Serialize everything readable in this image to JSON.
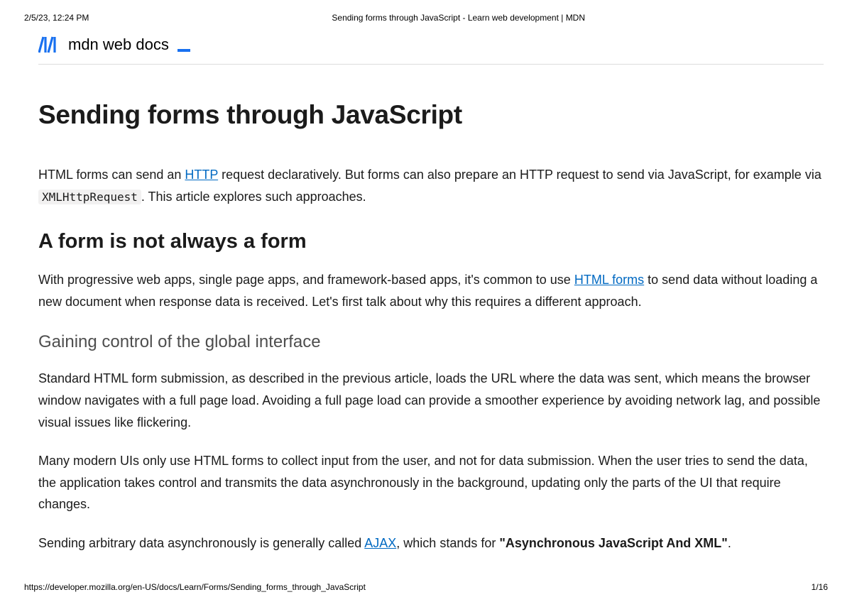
{
  "print": {
    "timestamp": "2/5/23, 12:24 PM",
    "title": "Sending forms through JavaScript - Learn web development | MDN",
    "url": "https://developer.mozilla.org/en-US/docs/Learn/Forms/Sending_forms_through_JavaScript",
    "page": "1/16"
  },
  "logo": {
    "text": "mdn web docs"
  },
  "article": {
    "title": "Sending forms through JavaScript",
    "intro": {
      "part1": "HTML forms can send an ",
      "link1": "HTTP",
      "part2": " request declaratively. But forms can also prepare an HTTP request to send via JavaScript, for example via ",
      "code1": "XMLHttpRequest",
      "part3": ". This article explores such approaches."
    },
    "h2_1": "A form is not always a form",
    "p2": {
      "part1": "With progressive web apps, single page apps, and framework-based apps, it's common to use ",
      "link1": "HTML forms",
      "part2": " to send data without loading a new document when response data is received. Let's first talk about why this requires a different approach."
    },
    "h3_1": "Gaining control of the global interface",
    "p3": "Standard HTML form submission, as described in the previous article, loads the URL where the data was sent, which means the browser window navigates with a full page load. Avoiding a full page load can provide a smoother experience by avoiding network lag, and possible visual issues like flickering.",
    "p4": "Many modern UIs only use HTML forms to collect input from the user, and not for data submission. When the user tries to send the data, the application takes control and transmits the data asynchronously in the background, updating only the parts of the UI that require changes.",
    "p5": {
      "part1": "Sending arbitrary data asynchronously is generally called ",
      "link1": "AJAX",
      "part2": ", which stands for ",
      "strong1": "\"Asynchronous JavaScript And XML\"",
      "part3": "."
    }
  }
}
